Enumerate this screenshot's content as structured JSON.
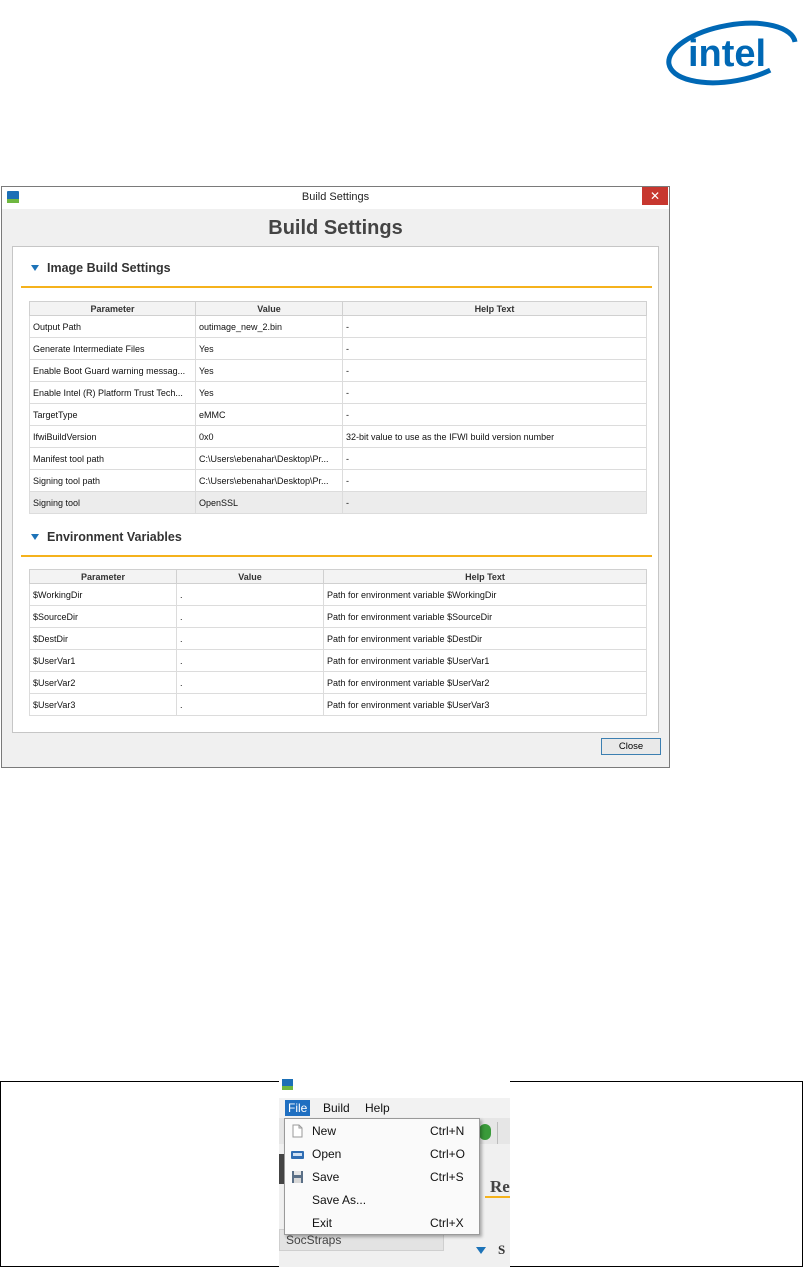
{
  "logo": {
    "text": "intel",
    "color": "#0068b5"
  },
  "dialog": {
    "window_title": "Build Settings",
    "close_glyph": "✕",
    "heading": "Build Settings",
    "sections": [
      {
        "title": "Image Build Settings",
        "columns": [
          "Parameter",
          "Value",
          "Help Text"
        ],
        "rows": [
          {
            "parameter": "Output Path",
            "value": "outimage_new_2.bin",
            "help": "-"
          },
          {
            "parameter": "Generate Intermediate Files",
            "value": "Yes",
            "help": "-"
          },
          {
            "parameter": "Enable Boot Guard warning messag...",
            "value": "Yes",
            "help": "-"
          },
          {
            "parameter": "Enable Intel (R) Platform Trust Tech...",
            "value": "Yes",
            "help": "-"
          },
          {
            "parameter": "TargetType",
            "value": "eMMC",
            "help": "-"
          },
          {
            "parameter": "IfwiBuildVersion",
            "value": "0x0",
            "help": "32-bit value to use as the IFWI build version number"
          },
          {
            "parameter": "Manifest tool path",
            "value": "C:\\Users\\ebenahar\\Desktop\\Pr...",
            "help": "-"
          },
          {
            "parameter": "Signing tool path",
            "value": "C:\\Users\\ebenahar\\Desktop\\Pr...",
            "help": "-"
          },
          {
            "parameter": "Signing tool",
            "value": "OpenSSL",
            "help": "-"
          }
        ]
      },
      {
        "title": "Environment Variables",
        "columns": [
          "Parameter",
          "Value",
          "Help Text"
        ],
        "rows": [
          {
            "parameter": "$WorkingDir",
            "value": ".",
            "help": "Path for environment variable $WorkingDir"
          },
          {
            "parameter": "$SourceDir",
            "value": ".",
            "help": "Path for environment variable $SourceDir"
          },
          {
            "parameter": "$DestDir",
            "value": ".",
            "help": "Path for environment variable $DestDir"
          },
          {
            "parameter": "$UserVar1",
            "value": ".",
            "help": "Path for environment variable $UserVar1"
          },
          {
            "parameter": "$UserVar2",
            "value": ".",
            "help": "Path for environment variable $UserVar2"
          },
          {
            "parameter": "$UserVar3",
            "value": ".",
            "help": "Path for environment variable $UserVar3"
          }
        ]
      }
    ],
    "close_button": "Close"
  },
  "menu_screenshot": {
    "menubar": [
      "File",
      "Build",
      "Help"
    ],
    "active_menu": "File",
    "file_menu_items": [
      {
        "label": "New",
        "shortcut": "Ctrl+N",
        "icon": "new-document-icon"
      },
      {
        "label": "Open",
        "shortcut": "Ctrl+O",
        "icon": "open-folder-icon"
      },
      {
        "label": "Save",
        "shortcut": "Ctrl+S",
        "icon": "floppy-disk-icon"
      },
      {
        "label": "Save As...",
        "shortcut": "",
        "icon": ""
      },
      {
        "label": "Exit",
        "shortcut": "Ctrl+X",
        "icon": ""
      }
    ],
    "background_heading_fragment": "Re",
    "background_section_fragment": "S",
    "sidebar_item": "SocStraps"
  },
  "colors": {
    "accent_blue": "#1d73b8",
    "section_underline": "#f5b21c",
    "close_red": "#c7372f",
    "menu_highlight": "#1f6fc1"
  }
}
